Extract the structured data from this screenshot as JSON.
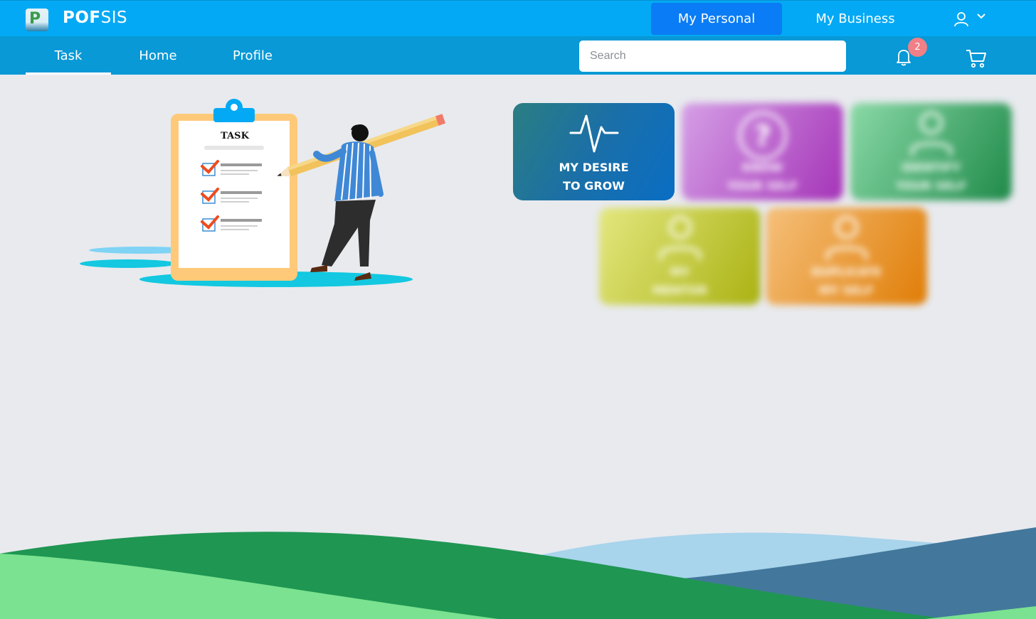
{
  "app": {
    "brand_bold": "POF",
    "brand_light": "SIS"
  },
  "header": {
    "modes": [
      "My Personal",
      "My Business"
    ],
    "active_mode": "My Personal"
  },
  "nav": {
    "tabs": [
      "Task",
      "Home",
      "Profile"
    ],
    "active_tab": "Task",
    "search_placeholder": "Search",
    "notification_count": "2"
  },
  "illustration": {
    "clipboard_title": "TASK"
  },
  "tiles": [
    {
      "line1": "MY DESIRE",
      "line2": "TO GROW",
      "icon": "pulse-icon",
      "blurred": false
    },
    {
      "line1": "KNOW",
      "line2": "YOUR SELF",
      "icon": "question-icon",
      "blurred": true
    },
    {
      "line1": "IDENTIFY",
      "line2": "YOUR SELF",
      "icon": "person-icon",
      "blurred": true
    },
    {
      "line1": "MY",
      "line2": "MENTOR",
      "icon": "person-icon",
      "blurred": true
    },
    {
      "line1": "DUPLICATE",
      "line2": "MY SELF",
      "icon": "person-icon",
      "blurred": true
    }
  ],
  "colors": {
    "topbar": "#03a9f4",
    "navbar": "#0899d6",
    "active_mode": "#0a7cf5",
    "badge": "#f07f86",
    "background": "#e8eaee"
  }
}
